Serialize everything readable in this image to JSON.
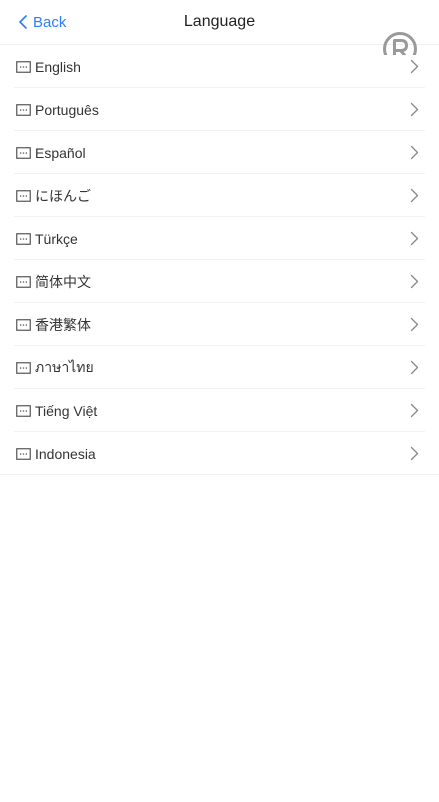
{
  "header": {
    "back_label": "Back",
    "title": "Language",
    "accent_color": "#2f7df6"
  },
  "icons": {
    "back": "chevron-left-icon",
    "item": "message-icon",
    "arrow": "chevron-right-icon",
    "logo": "registered-mark-icon"
  },
  "languages": [
    {
      "label": "English"
    },
    {
      "label": "Português"
    },
    {
      "label": "Español"
    },
    {
      "label": "にほんご"
    },
    {
      "label": "Türkçe"
    },
    {
      "label": "简体中文"
    },
    {
      "label": "香港繁体"
    },
    {
      "label": "ภาษาไทย"
    },
    {
      "label": "Tiếng Việt"
    },
    {
      "label": "Indonesia"
    }
  ]
}
